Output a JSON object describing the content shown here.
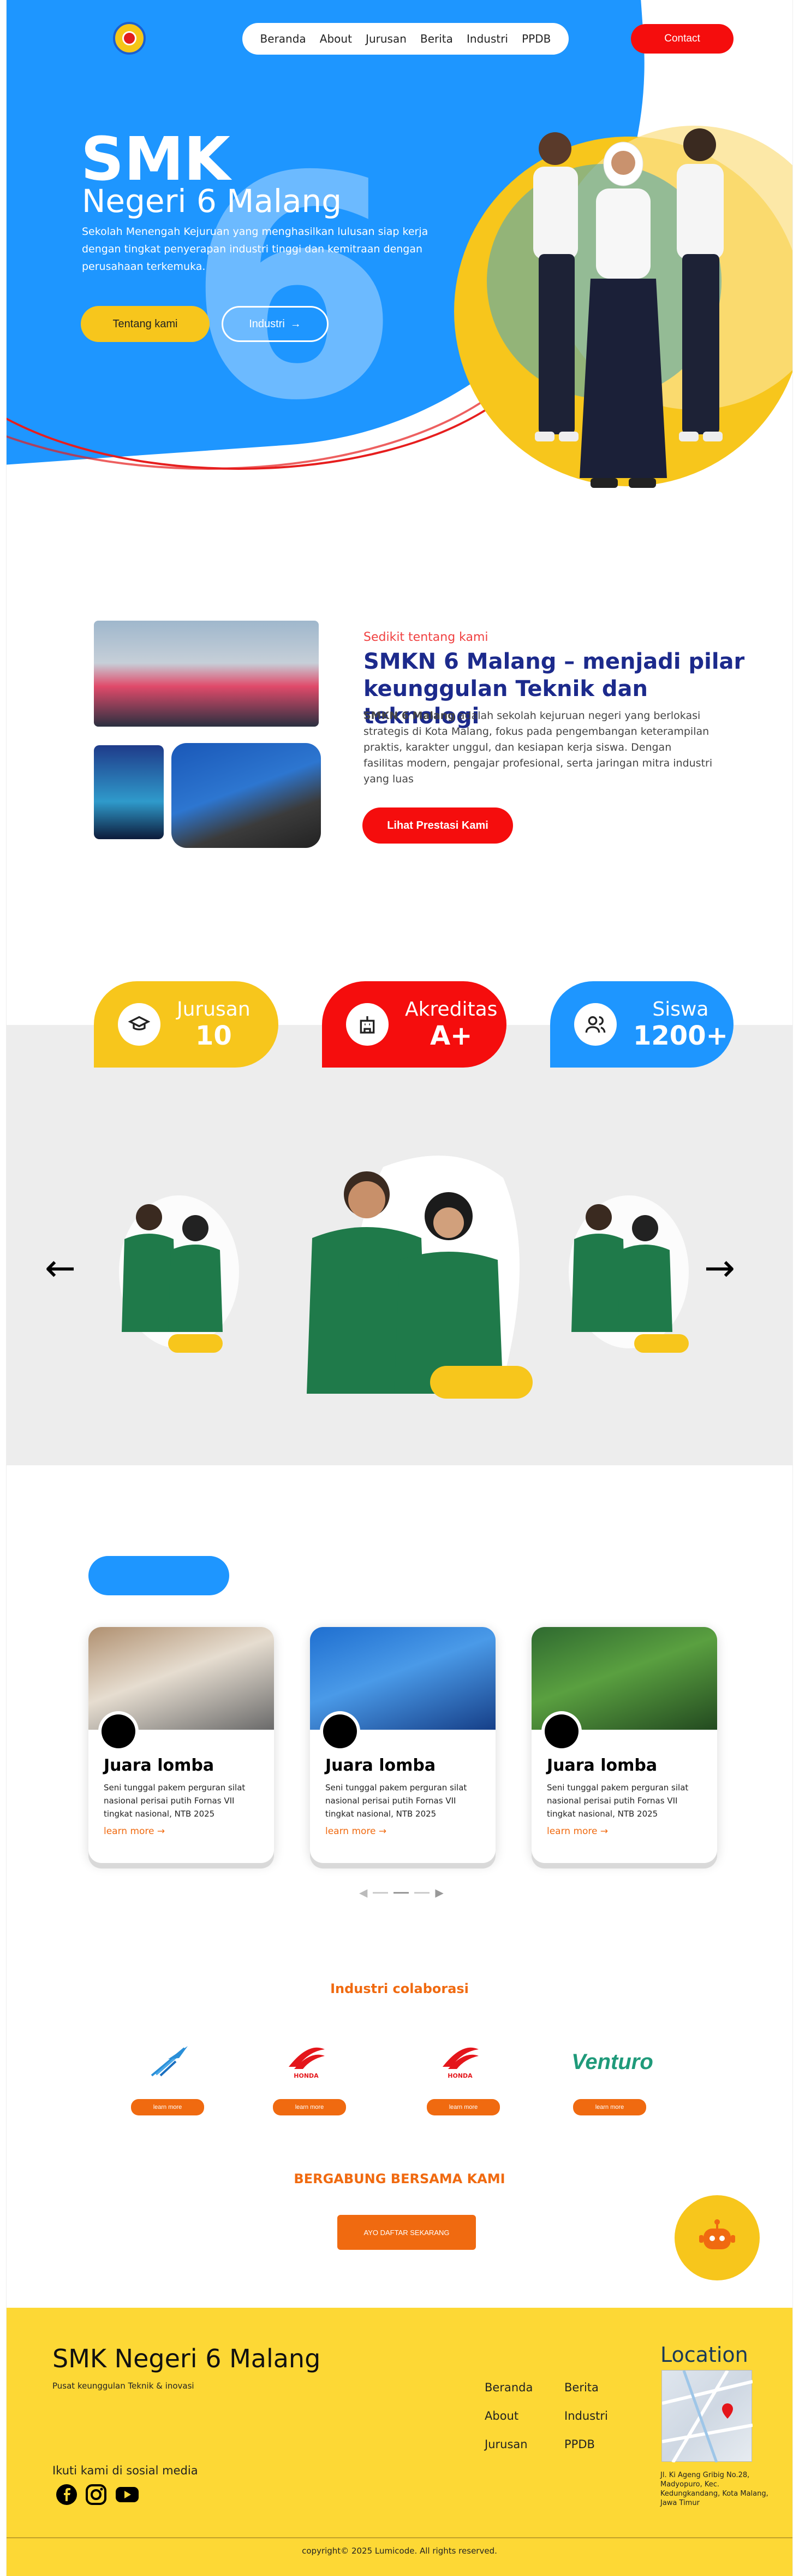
{
  "nav": {
    "items": [
      "Beranda",
      "About",
      "Jurusan",
      "Berita",
      "Industri",
      "PPDB"
    ],
    "contact_label": "Contact"
  },
  "hero": {
    "title": "SMK",
    "subtitle": "Negeri 6 Malang",
    "description": "Sekolah Menengah Kejuruan yang menghasilkan lulusan siap kerja dengan tingkat penyerapan industri tinggi dan kemitraan dengan perusahaan terkemuka.",
    "button_primary": "Tentang kami",
    "button_secondary": "Industri",
    "background_numeral": "6"
  },
  "about": {
    "eyebrow": "Sedikit tentang kami",
    "title": "SMKN 6 Malang – menjadi pilar keunggulan Teknik dan teknologi",
    "text_strong": "SMKN 6 Malang",
    "text_rest": " adalah sekolah kejuruan negeri yang berlokasi strategis di Kota Malang, fokus pada pengembangan keterampilan praktis, karakter unggul, dan kesiapan kerja siswa. Dengan fasilitas modern, pengajar profesional, serta jaringan mitra industri yang luas",
    "button": "Lihat Prestasi Kami"
  },
  "stats": [
    {
      "label": "Jurusan",
      "value": "10",
      "color": "#f7c61c",
      "icon": "graduation-cap-icon"
    },
    {
      "label": "Akreditas",
      "value": "A+",
      "color": "#f50d0d",
      "icon": "building-icon"
    },
    {
      "label": "Siswa",
      "value": "1200+",
      "color": "#1e96ff",
      "icon": "users-icon"
    }
  ],
  "carousel": {
    "prev": "←",
    "next": "→"
  },
  "news": {
    "cards": [
      {
        "title": "Juara lomba",
        "text": "Seni tunggal pakem perguran silat nasional perisai putih Fornas VII tingkat nasional, NTB 2025",
        "link": "learn more →"
      },
      {
        "title": "Juara lomba",
        "text": "Seni tunggal pakem perguran silat nasional perisai putih Fornas VII tingkat nasional, NTB 2025",
        "link": "learn more →"
      },
      {
        "title": "Juara lomba",
        "text": "Seni tunggal pakem perguran silat nasional perisai putih Fornas VII tingkat nasional, NTB 2025",
        "link": "learn more →"
      }
    ]
  },
  "industry": {
    "title": "Industri colaborasi",
    "logos": [
      "",
      "HONDA",
      "HONDA",
      "Venturo"
    ],
    "button": "learn more"
  },
  "join": {
    "title": "BERGABUNG BERSAMA KAMI",
    "button": "AYO DAFTAR SEKARANG"
  },
  "footer": {
    "brand": "SMK Negeri 6 Malang",
    "tagline": "Pusat keunggulan Teknik & inovasi",
    "follow": "Ikuti kami di sosial media",
    "links_col1": [
      "Beranda",
      "About",
      "Jurusan"
    ],
    "links_col2": [
      "Berita",
      "Industri",
      "PPDB"
    ],
    "location_title": "Location",
    "address": "Jl. Ki Ageng Gribig No.28, Madyopuro, Kec. Kedungkandang, Kota Malang, Jawa Timur",
    "copyright": "copyright© 2025 Lumicode. All rights reserved."
  }
}
